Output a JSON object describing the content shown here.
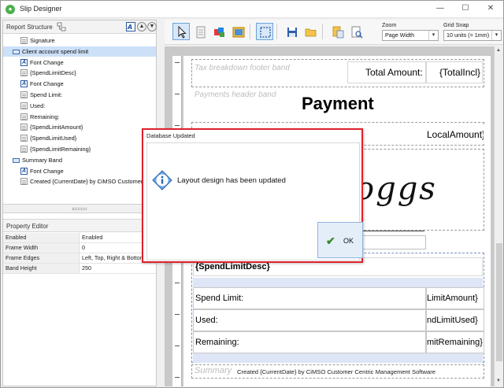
{
  "window": {
    "title": "Slip Designer",
    "minimize": "—",
    "maximize": "☐",
    "close": "✕"
  },
  "report_structure": {
    "title": "Report Structure",
    "items": [
      {
        "label": "Signature",
        "icon": "doc",
        "indent": 2,
        "selected": false
      },
      {
        "label": "Client account spend limit",
        "icon": "band",
        "indent": 1,
        "selected": true
      },
      {
        "label": "Font Change",
        "icon": "font",
        "indent": 2,
        "selected": false
      },
      {
        "label": "{SpendLimitDesc}",
        "icon": "doc",
        "indent": 2,
        "selected": false
      },
      {
        "label": "Font Change",
        "icon": "font",
        "indent": 2,
        "selected": false
      },
      {
        "label": "Spend Limit:",
        "icon": "doc",
        "indent": 2,
        "selected": false
      },
      {
        "label": "Used:",
        "icon": "doc",
        "indent": 2,
        "selected": false
      },
      {
        "label": "Remaining:",
        "icon": "doc",
        "indent": 2,
        "selected": false
      },
      {
        "label": "{SpendLimitAmount}",
        "icon": "doc",
        "indent": 2,
        "selected": false
      },
      {
        "label": "{SpendLimitUsed}",
        "icon": "doc",
        "indent": 2,
        "selected": false
      },
      {
        "label": "{SpendLimitRemaining}",
        "icon": "doc",
        "indent": 2,
        "selected": false
      },
      {
        "label": "Summary Band",
        "icon": "band",
        "indent": 1,
        "selected": false
      },
      {
        "label": "Font Change",
        "icon": "font",
        "indent": 2,
        "selected": false
      },
      {
        "label": "Created {CurrentDate} by CiMSO Customer Ce",
        "icon": "doc",
        "indent": 2,
        "selected": false
      }
    ]
  },
  "property_editor": {
    "title": "Property Editor",
    "rows": [
      {
        "key": "Enabled",
        "value": "Enabled"
      },
      {
        "key": "Frame Width",
        "value": "0"
      },
      {
        "key": "Frame Edges",
        "value": "Left, Top, Right & Bottom"
      },
      {
        "key": "Band Height",
        "value": "250"
      }
    ]
  },
  "toolbar": {
    "zoom_label": "Zoom",
    "zoom_value": "Page Width",
    "grid_label": "Grid Snap",
    "grid_value": "10 units (= 1mm)"
  },
  "canvas": {
    "tax_footer_label": "Tax breakdown footer band",
    "total_amount_label": "Total Amount:",
    "total_incl": "{TotalIncl}",
    "payments_header_label": "Payments header band",
    "payment_title": "Payment",
    "local_amount": "LocalAmount}",
    "signature_text": "oggs",
    "spend_limit_desc": "{SpendLimitDesc}",
    "spend_limit_label": "Spend Limit:",
    "spend_limit_amount": "LimitAmount}",
    "used_label": "Used:",
    "used_value": "ndLimitUsed}",
    "remaining_label": "Remaining:",
    "remaining_value": "mitRemaining}",
    "summary_label": "Summary",
    "created_text": "Created {CurrentDate} by CiMSO Customer Centric Management Software"
  },
  "dialog": {
    "title": "Database Updated",
    "message": "Layout design has been updated",
    "ok_label": "OK"
  },
  "colors": {
    "dialog_border": "#e0202a",
    "selection": "#cce0f8",
    "band_highlight": "#dde5f6",
    "ok_check": "#3c8a2e"
  }
}
